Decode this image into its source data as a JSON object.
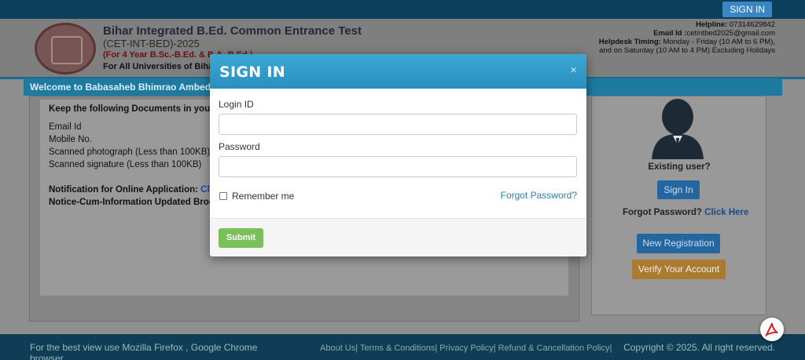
{
  "topbar": {
    "signin_label": "SIGN IN"
  },
  "header": {
    "title": "Bihar Integrated B.Ed. Common Entrance Test",
    "subtitle": "(CET-INT-BED)-2025",
    "course": "(For 4 Year B.Sc.-B.Ed. & B.A.-B.Ed.)",
    "universities": "For All Universities of Bihar F",
    "helpline_label": "Helpline:",
    "helpline_value": "07314629842",
    "email_label": "Email Id :",
    "email_value": "cetintbed2025@gmail.com",
    "timing_label": "Helpdesk Timing:",
    "timing_value": "Monday - Friday (10 AM to 6 PM),",
    "timing_value2": "and on Saturday (10 AM to 4 PM) Excluding Holidays"
  },
  "welcome": {
    "text": "Welcome to Babasaheb Bhimrao Ambed"
  },
  "left_panel": {
    "docs_heading": "Keep the following Documents in your ha",
    "docs": [
      "Email Id",
      "Mobile No.",
      "Scanned photograph (Less than 100KB)",
      "Scanned signature (Less than 100KB)"
    ],
    "notification_label": "Notification for Online Application:",
    "notification_link": "Click",
    "notice_label": "Notice-Cum-Information Updated Broch"
  },
  "right_panel": {
    "existing_user": "Existing user?",
    "signin_label": "Sign In",
    "forgot_label": "Forgot Password?",
    "forgot_link": "Click Here",
    "new_registration": "New Registration",
    "verify_account": "Verify Your Account"
  },
  "footer": {
    "best_view": "For the best view use Mozilla Firefox , Google Chrome browser",
    "links": "About Us| Terms & Conditions| Privacy Policy| Refund & Cancellation Policy|",
    "copyright": "Copyright © 2025. All right reserved."
  },
  "modal": {
    "title": "SIGN IN",
    "close_glyph": "×",
    "login_id_label": "Login ID",
    "login_id_value": "",
    "password_label": "Password",
    "password_value": "",
    "remember_me": "Remember me",
    "forgot_password": "Forgot Password?",
    "submit_label": "Submit"
  },
  "colors": {
    "accent": "#2a8fc0",
    "submit": "#79c05b",
    "link": "#2f7bb0"
  }
}
